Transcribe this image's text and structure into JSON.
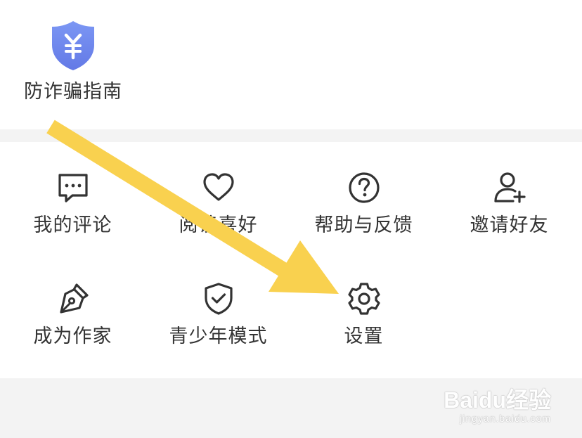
{
  "antifraud": {
    "label": "防诈骗指南",
    "icon": "shield-yen-icon",
    "color": "#6f8cf0"
  },
  "menu": {
    "items": [
      {
        "label": "我的评论",
        "icon": "comment-icon"
      },
      {
        "label": "阅读喜好",
        "icon": "heart-icon"
      },
      {
        "label": "帮助与反馈",
        "icon": "help-icon"
      },
      {
        "label": "邀请好友",
        "icon": "add-user-icon"
      },
      {
        "label": "成为作家",
        "icon": "pen-icon"
      },
      {
        "label": "青少年模式",
        "icon": "shield-check-icon"
      },
      {
        "label": "设置",
        "icon": "gear-icon"
      }
    ]
  },
  "annotation": {
    "arrow_color": "#f9d14f"
  },
  "watermark": {
    "main": "Baidu经验",
    "sub": "jingyan.baidu.com"
  }
}
